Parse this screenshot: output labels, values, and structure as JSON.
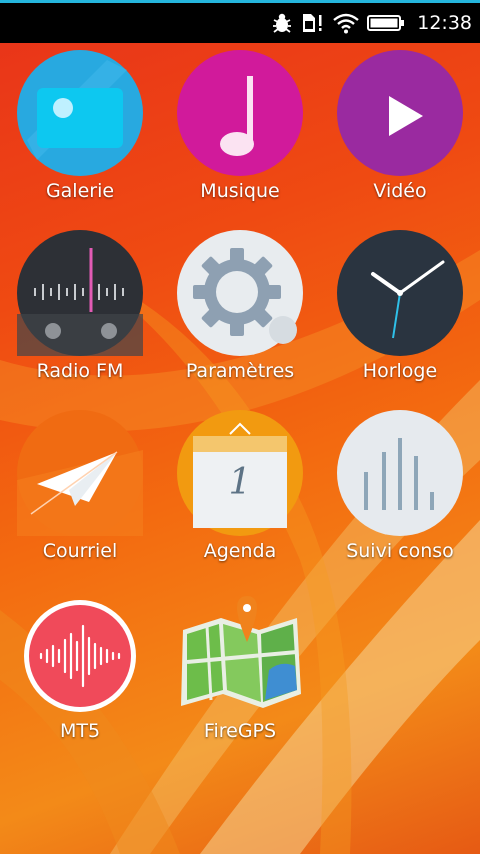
{
  "status_bar": {
    "time": "12:38",
    "icons": [
      "bug-icon",
      "sim-card-icon",
      "wifi-icon",
      "battery-icon"
    ],
    "accent_color": "#25b6dd"
  },
  "apps": [
    {
      "label": "Galerie",
      "icon": "gallery-icon",
      "color": "#28a9e0"
    },
    {
      "label": "Musique",
      "icon": "music-note-icon",
      "color": "#d11a9b"
    },
    {
      "label": "Vidéo",
      "icon": "play-icon",
      "color": "#9a2aa0"
    },
    {
      "label": "Radio FM",
      "icon": "radio-icon",
      "color": "#2d3036"
    },
    {
      "label": "Paramètres",
      "icon": "gear-icon",
      "color": "#e8ecef"
    },
    {
      "label": "Horloge",
      "icon": "clock-icon",
      "color": "#2a3440"
    },
    {
      "label": "Courriel",
      "icon": "paper-plane-icon",
      "color": "#f06b12"
    },
    {
      "label": "Agenda",
      "icon": "calendar-icon",
      "color": "#f29a10",
      "day": "1"
    },
    {
      "label": "Suivi conso",
      "icon": "usage-bars-icon",
      "color": "#e6eaee"
    },
    {
      "label": "MT5",
      "icon": "waveform-icon",
      "color": "#f04a5a"
    },
    {
      "label": "FireGPS",
      "icon": "map-pin-icon",
      "color": "#4caf50"
    }
  ]
}
